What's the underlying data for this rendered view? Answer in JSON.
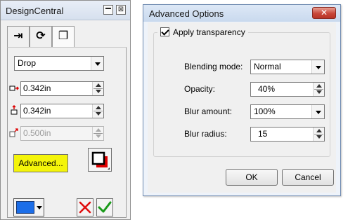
{
  "design_central": {
    "title": "DesignCentral",
    "minimize_label": "minimize",
    "close_label": "⊠",
    "tabs": [
      {
        "icon": "move-icon",
        "glyph": "⇥"
      },
      {
        "icon": "rotate-icon",
        "glyph": "⟳"
      },
      {
        "icon": "shadow-tab-icon",
        "glyph": "❐"
      }
    ],
    "shadow_type": "Drop",
    "offset_x": "0.342in",
    "offset_y": "0.342in",
    "depth": "0.500in",
    "advanced_label": "Advanced...",
    "shadow_color": "#1c6ee8"
  },
  "advanced_options": {
    "title": "Advanced Options",
    "close_glyph": "✕",
    "apply_transparency_label": "Apply transparency",
    "apply_transparency_checked": true,
    "blending_mode_label": "Blending mode:",
    "blending_mode_value": "Normal",
    "opacity_label": "Opacity:",
    "opacity_value": "40%",
    "blur_amount_label": "Blur amount:",
    "blur_amount_value": "100%",
    "blur_radius_label": "Blur radius:",
    "blur_radius_value": "15",
    "ok_label": "OK",
    "cancel_label": "Cancel"
  }
}
